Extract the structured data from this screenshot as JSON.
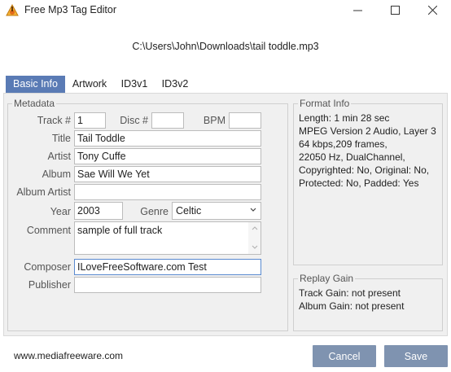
{
  "window": {
    "title": "Free Mp3 Tag Editor",
    "app_icon": "mp3-tag-editor-icon"
  },
  "file_path": "C:\\Users\\John\\Downloads\\tail toddle.mp3",
  "tabs": [
    {
      "label": "Basic Info",
      "active": true
    },
    {
      "label": "Artwork",
      "active": false
    },
    {
      "label": "ID3v1",
      "active": false
    },
    {
      "label": "ID3v2",
      "active": false
    }
  ],
  "metadata": {
    "group_title": "Metadata",
    "track_label": "Track #",
    "track_value": "1",
    "disc_label": "Disc #",
    "disc_value": "",
    "bpm_label": "BPM",
    "bpm_value": "",
    "title_label": "Title",
    "title_value": "Tail Toddle",
    "artist_label": "Artist",
    "artist_value": "Tony Cuffe",
    "album_label": "Album",
    "album_value": "Sae Will We Yet",
    "album_artist_label": "Album Artist",
    "album_artist_value": "",
    "year_label": "Year",
    "year_value": "2003",
    "genre_label": "Genre",
    "genre_value": "Celtic",
    "comment_label": "Comment",
    "comment_value": "sample of full track",
    "composer_label": "Composer",
    "composer_value": "ILoveFreeSoftware.com Test",
    "publisher_label": "Publisher",
    "publisher_value": ""
  },
  "format_info": {
    "group_title": "Format Info",
    "lines": [
      "Length: 1 min 28 sec",
      "MPEG Version 2 Audio, Layer 3",
      "64 kbps,209 frames,",
      "22050 Hz, DualChannel,",
      "Copyrighted: No, Original: No,",
      "Protected: No, Padded: Yes"
    ]
  },
  "replay_gain": {
    "group_title": "Replay Gain",
    "lines": [
      "Track Gain: not present",
      "Album Gain: not present"
    ]
  },
  "footer": {
    "website": "www.mediafreeware.com",
    "cancel_label": "Cancel",
    "save_label": "Save"
  },
  "colors": {
    "active_tab": "#5a7bb5",
    "button": "#7f93b0",
    "panel": "#f0f0f0"
  }
}
